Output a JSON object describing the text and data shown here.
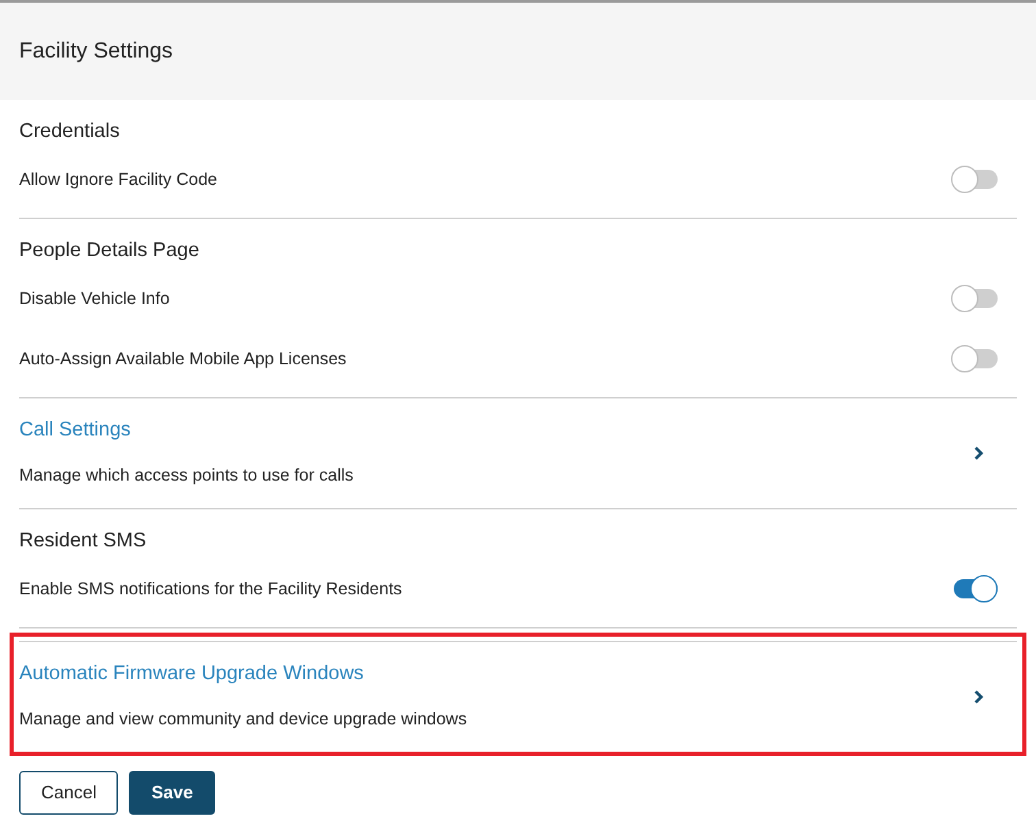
{
  "header": {
    "title": "Facility Settings"
  },
  "sections": [
    {
      "kind": "toggles",
      "title": "Credentials",
      "highlighted": false,
      "rows": [
        {
          "label": "Allow Ignore Facility Code",
          "on": false
        }
      ]
    },
    {
      "kind": "toggles",
      "title": "People Details Page",
      "highlighted": false,
      "rows": [
        {
          "label": "Disable Vehicle Info",
          "on": false
        },
        {
          "label": "Auto-Assign Available Mobile App Licenses",
          "on": false
        }
      ]
    },
    {
      "kind": "link",
      "title": "Call Settings",
      "description": "Manage which access points to use for calls",
      "highlighted": false
    },
    {
      "kind": "toggles",
      "title": "Resident SMS",
      "highlighted": false,
      "rows": [
        {
          "label": "Enable SMS notifications for the Facility Residents",
          "on": true
        }
      ]
    },
    {
      "kind": "link",
      "title": "Automatic Firmware Upgrade Windows",
      "description": "Manage and view community and device upgrade windows",
      "highlighted": true
    }
  ],
  "buttons": [
    {
      "label": "Cancel",
      "kind": "secondary"
    },
    {
      "label": "Save",
      "kind": "primary"
    }
  ]
}
